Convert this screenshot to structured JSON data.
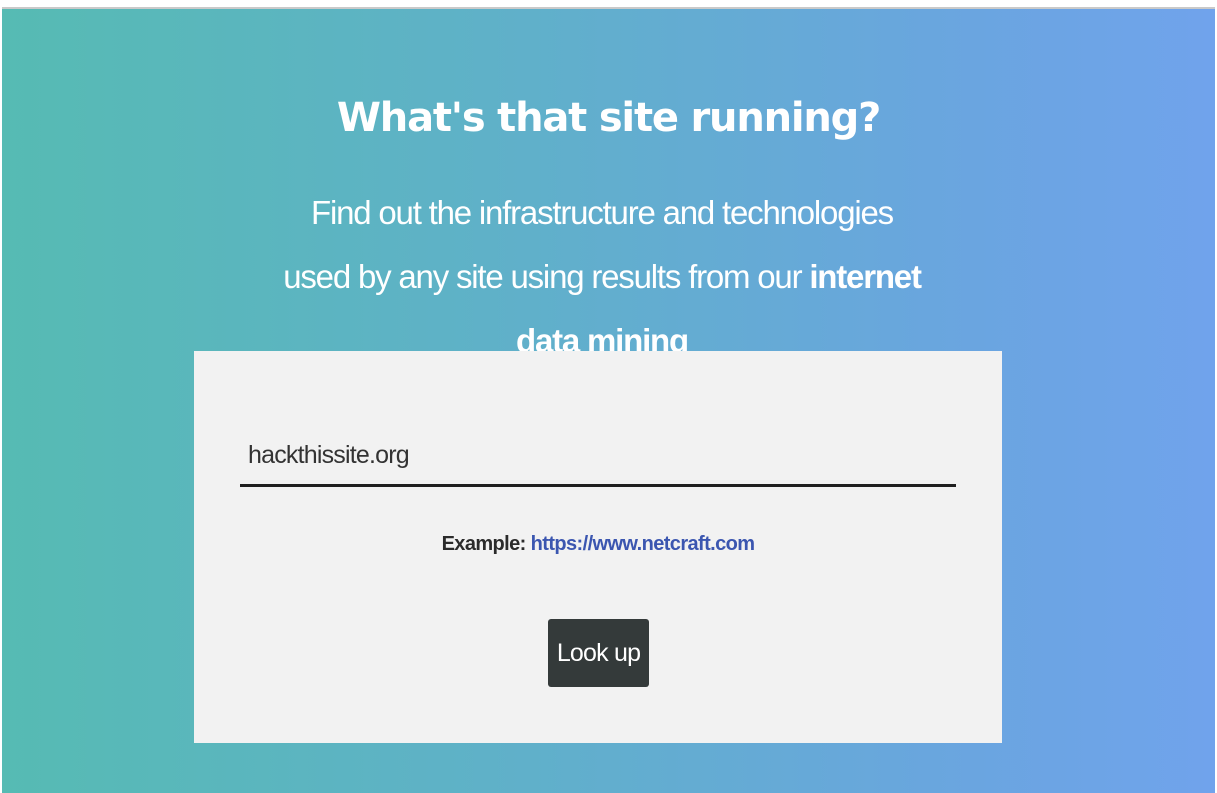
{
  "hero": {
    "title": "What's that site running?",
    "subtitle_plain": "Find out the infrastructure and technologies used by any site using results from our ",
    "subtitle_bold": "internet data mining"
  },
  "search": {
    "value": "hackthissite.org",
    "example_label": "Example:",
    "example_link": "https://www.netcraft.com",
    "button_label": "Look up"
  },
  "colors": {
    "gradient_start": "#56bbb3",
    "gradient_end": "#70a3ec",
    "button_bg": "#343a3a",
    "link": "#3b56b0"
  }
}
